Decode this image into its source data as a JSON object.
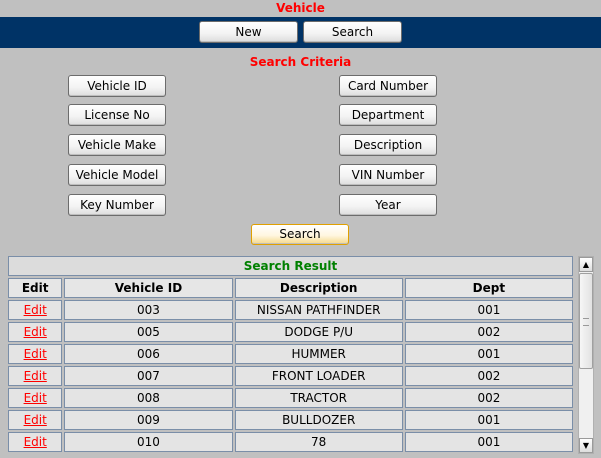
{
  "page": {
    "title": "Vehicle"
  },
  "toolbar": {
    "new_label": "New",
    "search_label": "Search"
  },
  "criteria": {
    "title": "Search Criteria",
    "left": [
      "Vehicle ID",
      "License No",
      "Vehicle Make",
      "Vehicle Model",
      "Key Number"
    ],
    "right": [
      "Card Number",
      "Department",
      "Description",
      "VIN Number",
      "Year"
    ],
    "search_label": "Search"
  },
  "result": {
    "title": "Search Result",
    "columns": [
      "Edit",
      "Vehicle ID",
      "Description",
      "Dept"
    ],
    "rows": [
      {
        "edit": "Edit",
        "id": "003",
        "desc": "NISSAN PATHFINDER",
        "dept": "001"
      },
      {
        "edit": "Edit",
        "id": "005",
        "desc": "DODGE P/U",
        "dept": "002"
      },
      {
        "edit": "Edit",
        "id": "006",
        "desc": "HUMMER",
        "dept": "001"
      },
      {
        "edit": "Edit",
        "id": "007",
        "desc": "FRONT LOADER",
        "dept": "002"
      },
      {
        "edit": "Edit",
        "id": "008",
        "desc": "TRACTOR",
        "dept": "002"
      },
      {
        "edit": "Edit",
        "id": "009",
        "desc": "BULLDOZER",
        "dept": "001"
      },
      {
        "edit": "Edit",
        "id": "010",
        "desc": "78",
        "dept": "001"
      }
    ]
  },
  "scrollbar": {
    "up_icon": "▲",
    "down_icon": "▼"
  },
  "colors": {
    "header_bg": "#003366",
    "title_red": "#ff0000",
    "result_green": "#008000"
  }
}
